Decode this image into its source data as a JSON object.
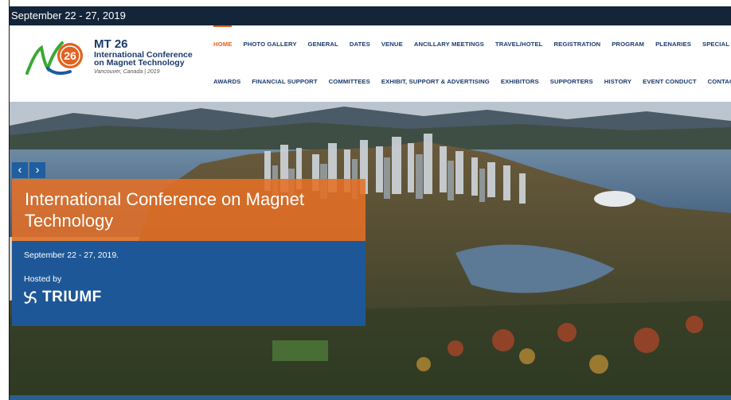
{
  "topbar": {
    "date_text": "September 22 - 27, 2019"
  },
  "logo": {
    "badge": "26",
    "title": "MT 26",
    "subtitle_line1": "International Conference",
    "subtitle_line2": "on Magnet Technology",
    "location": "Vancouver, Canada | 2019"
  },
  "nav": {
    "row1": [
      {
        "label": "HOME",
        "active": true
      },
      {
        "label": "PHOTO GALLERY",
        "active": false
      },
      {
        "label": "GENERAL",
        "active": false
      },
      {
        "label": "DATES",
        "active": false
      },
      {
        "label": "VENUE",
        "active": false
      },
      {
        "label": "ANCILLARY MEETINGS",
        "active": false
      },
      {
        "label": "TRAVEL/HOTEL",
        "active": false
      },
      {
        "label": "REGISTRATION",
        "active": false
      },
      {
        "label": "PROGRAM",
        "active": false
      },
      {
        "label": "PLENARIES",
        "active": false
      },
      {
        "label": "SPECIAL SESSION",
        "active": false
      }
    ],
    "row2": [
      {
        "label": "AWARDS"
      },
      {
        "label": "FINANCIAL SUPPORT"
      },
      {
        "label": "COMMITTEES"
      },
      {
        "label": "EXHIBIT, SUPPORT & ADVERTISING"
      },
      {
        "label": "EXHIBITORS"
      },
      {
        "label": "SUPPORTERS"
      },
      {
        "label": "HISTORY"
      },
      {
        "label": "EVENT CONDUCT"
      },
      {
        "label": "CONTACT"
      }
    ]
  },
  "slider": {
    "prev_icon": "chevron-left-icon",
    "next_icon": "chevron-right-icon",
    "prev_glyph": "‹",
    "next_glyph": "›"
  },
  "hero": {
    "title": "International Conference on Magnet Technology",
    "date": "September 22 - 27, 2019.",
    "hosted_by": "Hosted by",
    "host_logo_text": "TRIUMF"
  },
  "colors": {
    "topbar": "#14253a",
    "brand_navy": "#1a3a6b",
    "accent_orange": "#e2621f",
    "caption_blue": "#1e5797",
    "slider_button": "#1f5ea0"
  }
}
